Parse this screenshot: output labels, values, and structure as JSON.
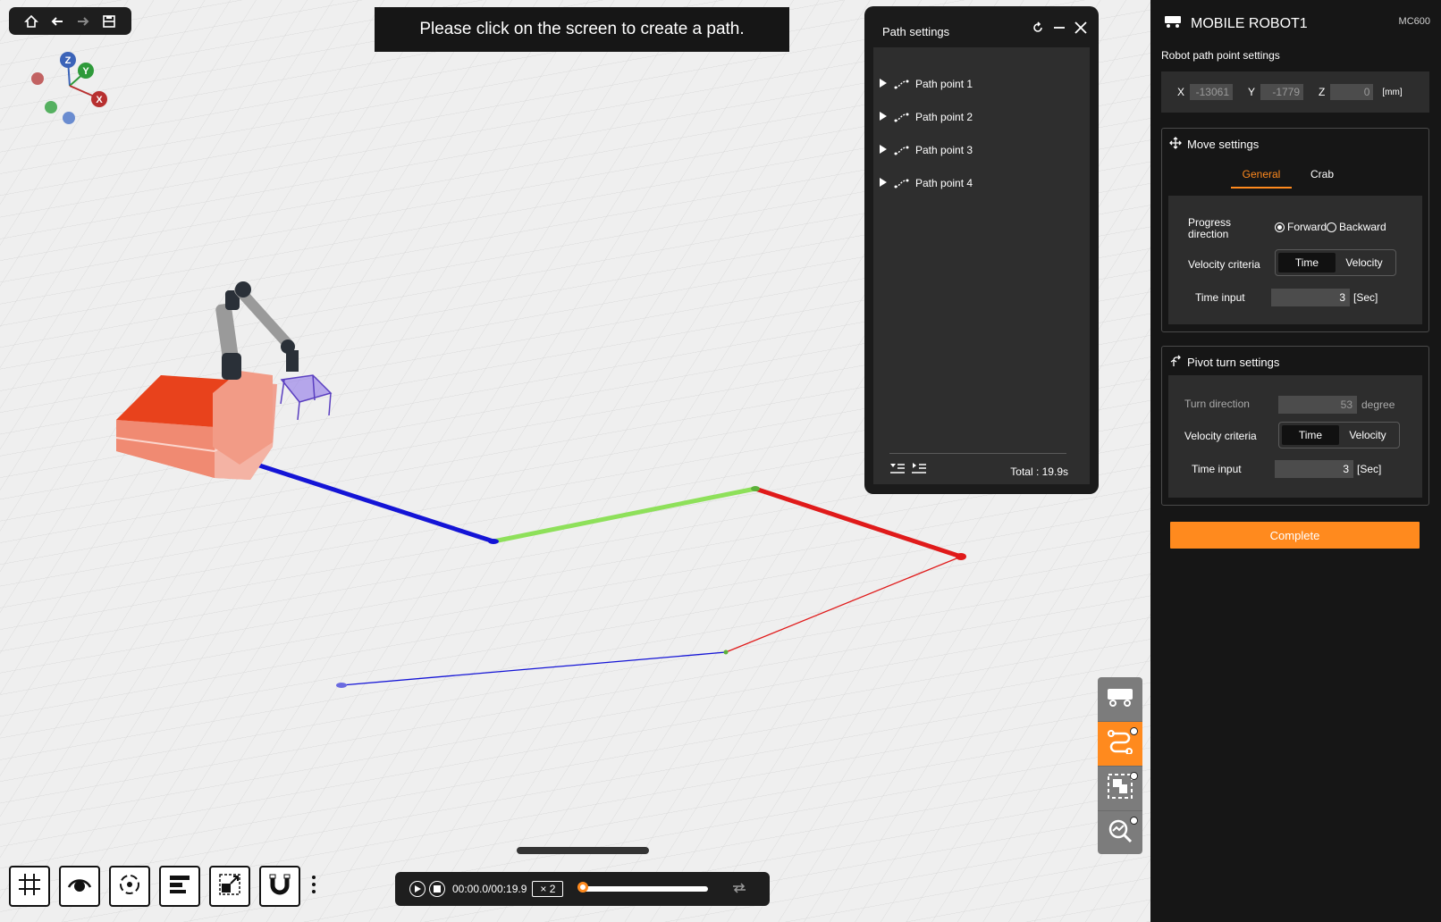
{
  "banner": {
    "text": "Please click on the screen to create a path."
  },
  "axis_gizmo": {
    "z": "Z",
    "y": "Y",
    "x": "X"
  },
  "path_panel": {
    "title": "Path settings",
    "items": [
      {
        "label": "Path point 1"
      },
      {
        "label": "Path point 2"
      },
      {
        "label": "Path point 3"
      },
      {
        "label": "Path point 4"
      }
    ],
    "total": "Total : 19.9s"
  },
  "playback": {
    "time": "00:00.0/00:19.9",
    "speed": "× 2",
    "progress": 0
  },
  "right_panel": {
    "robot_name": "MOBILE ROBOT1",
    "model": "MC600",
    "path_point_title": "Robot path point settings",
    "coords": {
      "x_label": "X",
      "x_value": "-13061",
      "y_label": "Y",
      "y_value": "-1779",
      "z_label": "Z",
      "z_value": "0",
      "unit": "[mm]"
    },
    "move": {
      "title": "Move settings",
      "tabs": [
        "General",
        "Crab"
      ],
      "progress_label": "Progress direction",
      "forward": "Forward",
      "backward": "Backward",
      "velocity_label": "Velocity criteria",
      "opt_time": "Time",
      "opt_velocity": "Velocity",
      "time_label": "Time input",
      "time_value": "3",
      "time_unit": "[Sec]"
    },
    "pivot": {
      "title": "Pivot turn settings",
      "turn_label": "Turn direction",
      "turn_value": "53",
      "turn_unit": "degree",
      "velocity_label": "Velocity criteria",
      "opt_time": "Time",
      "opt_velocity": "Velocity",
      "time_label": "Time input",
      "time_value": "3",
      "time_unit": "[Sec]"
    },
    "complete_label": "Complete"
  },
  "colors": {
    "accent": "#ff8a1e",
    "path_blue": "#1414d6",
    "path_green": "#8ee05a",
    "path_red": "#e01a1a",
    "robot_base": "#e8421c",
    "gripper": "#7b5cd6"
  }
}
